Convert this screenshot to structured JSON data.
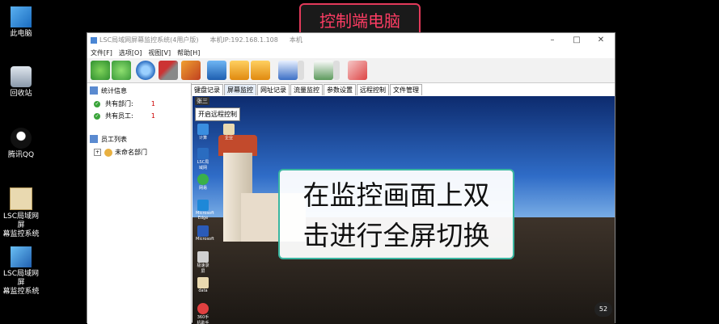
{
  "desktop": {
    "icons": [
      {
        "name": "此电脑"
      },
      {
        "name": "回收站"
      },
      {
        "name": "腾讯QQ"
      },
      {
        "name": "LSC局域网屏幕监控系统",
        "line1": "LSC局域网屏",
        "line2": "幕监控系统"
      },
      {
        "name": "LSC局域网屏幕监控系统",
        "line1": "LSC局域网屏",
        "line2": "幕监控系统"
      }
    ]
  },
  "banner": {
    "text": "控制端电脑"
  },
  "window": {
    "title": "LSC局域网屏幕监控系统(4用户版)",
    "ip": "本机IP:192.168.1.108",
    "ip_tail": "本机",
    "menu": [
      "文件[F]",
      "选项[O]",
      "视图[V]",
      "帮助[H]"
    ],
    "left_panel": {
      "stats_title": "统计信息",
      "dept_label": "共有部门:",
      "dept_count": "1",
      "emp_label": "共有员工:",
      "emp_count": "1",
      "employee_list_title": "员工列表",
      "unnamed_dept": "未命名部门"
    },
    "tabs": [
      "键盘记录",
      "屏幕监控",
      "网址记录",
      "流量监控",
      "参数设置",
      "远程控制",
      "文件管理"
    ],
    "active_tab": 1,
    "screen": {
      "remote_button": "开启远程控制",
      "screen_label": "张三",
      "icons": [
        {
          "label": "计算"
        },
        {
          "label": "企业"
        },
        {
          "label": "LSC局域网"
        },
        {
          "label": "网易"
        },
        {
          "label": "Microsoft Edge"
        },
        {
          "label": "Microsoft"
        },
        {
          "label": "极速录屏"
        },
        {
          "label": "data"
        },
        {
          "label": "360手机助手"
        }
      ],
      "clock": "52"
    }
  },
  "overlay": {
    "line1": "在监控画面上双",
    "line2": "击进行全屏切换"
  }
}
